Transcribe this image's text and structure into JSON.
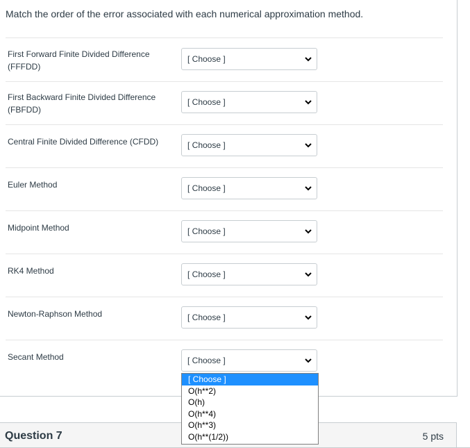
{
  "prompt": "Match the order of the error associated with each numerical approximation method.",
  "rows": [
    {
      "label": "First Forward Finite Divided Difference (FFFDD)",
      "value": "[ Choose ]"
    },
    {
      "label": "First Backward Finite Divided Difference (FBFDD)",
      "value": "[ Choose ]"
    },
    {
      "label": "Central Finite Divided Difference (CFDD)",
      "value": "[ Choose ]"
    },
    {
      "label": "Euler Method",
      "value": "[ Choose ]"
    },
    {
      "label": "Midpoint Method",
      "value": "[ Choose ]"
    },
    {
      "label": "RK4 Method",
      "value": "[ Choose ]"
    },
    {
      "label": "Newton-Raphson Method",
      "value": "[ Choose ]"
    },
    {
      "label": "Secant Method",
      "value": "[ Choose ]"
    }
  ],
  "dropdown_options": [
    "[ Choose ]",
    "O(h**2)",
    "O(h)",
    "O(h**4)",
    "O(h**3)",
    "O(h**(1/2))"
  ],
  "next_question": {
    "title": "Question 7",
    "points": "5 pts"
  },
  "colors": {
    "highlight": "#1e90ff",
    "text": "#2d3b45",
    "border": "#c7cdd1"
  },
  "icons": {
    "select_arrow": "chevron-down-icon"
  }
}
